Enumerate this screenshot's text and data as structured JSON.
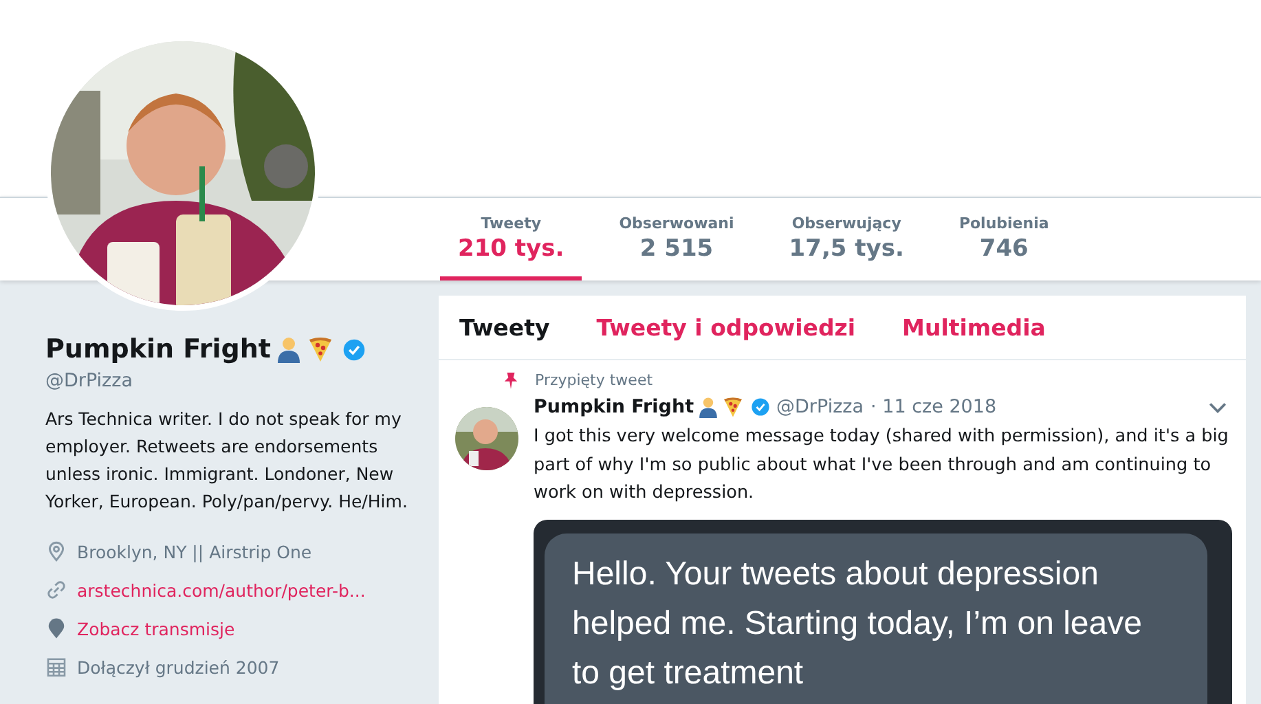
{
  "profile": {
    "name": "Pumpkin Fright",
    "verified": true,
    "handle": "@DrPizza",
    "bio": "Ars Technica writer. I do not speak for my employer. Retweets are endorsements unless ironic. Immigrant. Londoner, New Yorker, European. Poly/pan/pervy. He/Him.",
    "details": [
      {
        "kind": "location",
        "text": "Brooklyn, NY || Airstrip One",
        "link": false
      },
      {
        "kind": "url",
        "text": "arstechnica.com/author/peter-b...",
        "link": true
      },
      {
        "kind": "periscope",
        "text": "Zobacz transmisje",
        "link": true
      },
      {
        "kind": "joined",
        "text": "Dołączył grudzień 2007",
        "link": false
      }
    ]
  },
  "stats": [
    {
      "label": "Tweety",
      "value": "210 tys.",
      "selected": true
    },
    {
      "label": "Obserwowani",
      "value": "2 515",
      "selected": false
    },
    {
      "label": "Obserwujący",
      "value": "17,5 tys.",
      "selected": false
    },
    {
      "label": "Polubienia",
      "value": "746",
      "selected": false
    }
  ],
  "tabs": [
    {
      "label": "Tweety",
      "selected": true
    },
    {
      "label": "Tweety i odpowiedzi",
      "selected": false
    },
    {
      "label": "Multimedia",
      "selected": false
    }
  ],
  "tweet": {
    "pinned_label": "Przypięty tweet",
    "name": "Pumpkin Fright",
    "verified": true,
    "handle": "@DrPizza",
    "date": "· 11 cze 2018",
    "text": "I got this very welcome message today (shared with permission), and it's a big part of why I'm so public about what I've been through and am continuing to work on with depression.",
    "image_text": "Hello. Your tweets about depression helped me. Starting today, I’m on leave to get treatment"
  }
}
